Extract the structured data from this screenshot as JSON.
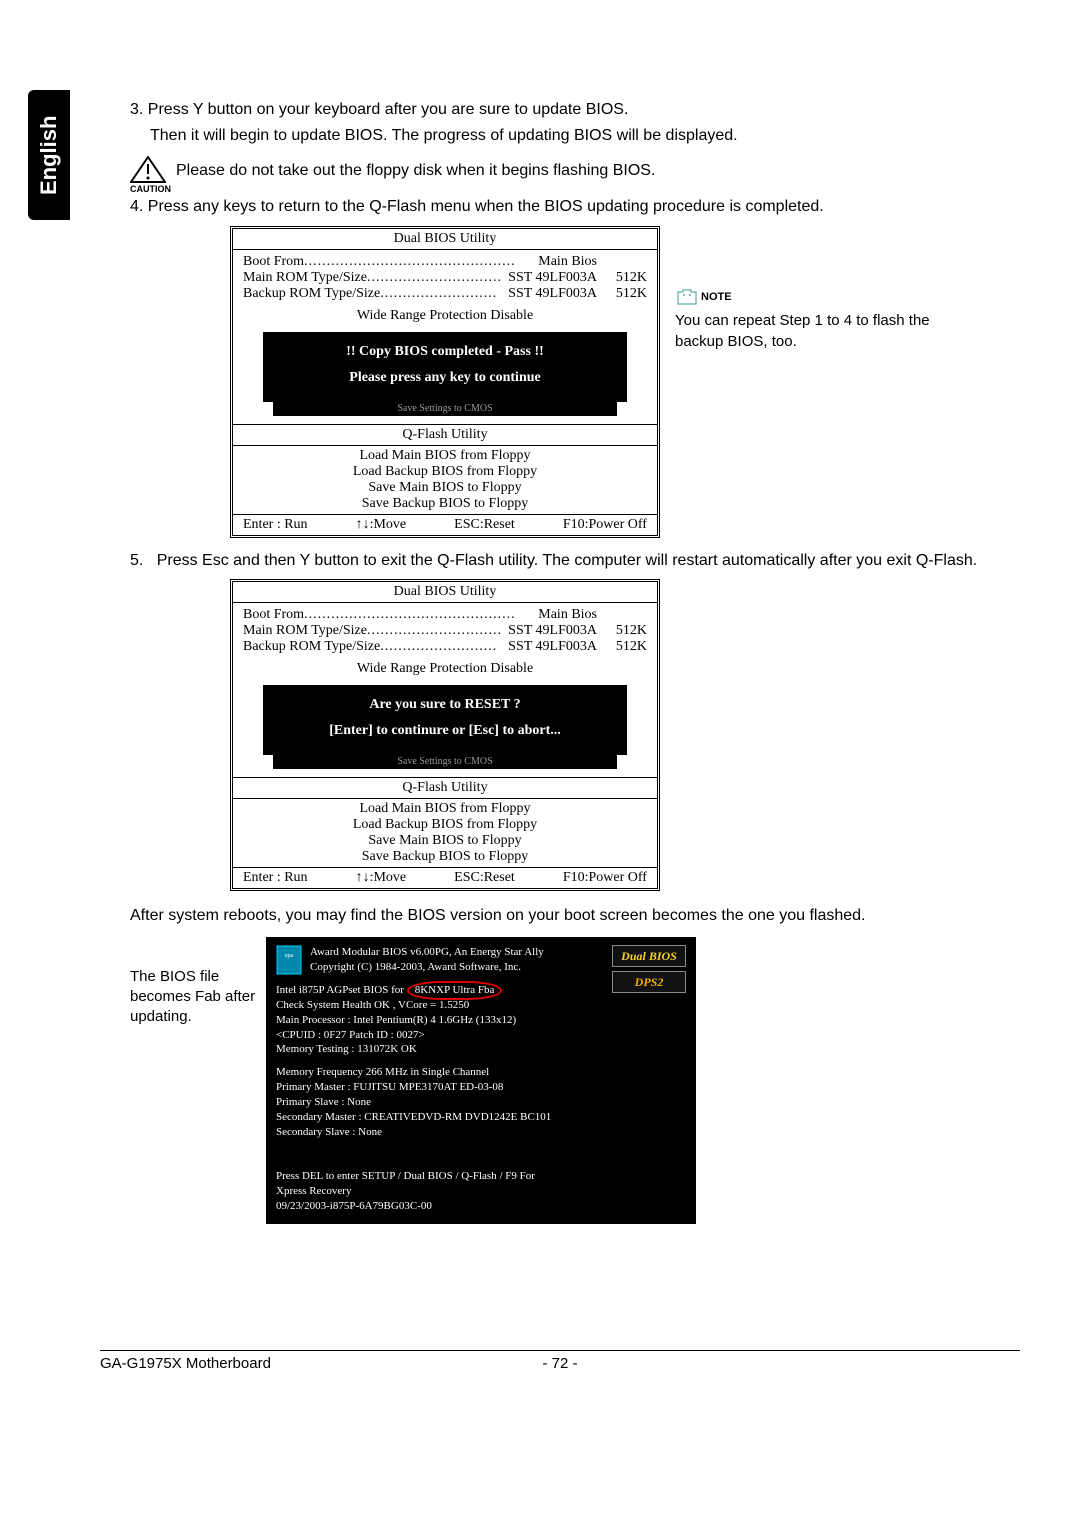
{
  "side_tab": "English",
  "step3": {
    "num": "3.",
    "line1": "Press Y button on your keyboard after you are sure to update BIOS.",
    "line2": "Then it will begin to update BIOS. The progress of updating BIOS will be displayed."
  },
  "caution": {
    "label": "CAUTION",
    "text": "Please do not take out the floppy disk when it begins flashing BIOS."
  },
  "step4": {
    "num": "4.",
    "text": "Press any keys to return to the Q-Flash menu when the BIOS updating procedure is completed."
  },
  "bios_common": {
    "title": "Dual BIOS Utility",
    "boot_from_label": "Boot From",
    "boot_from_value": "Main Bios",
    "main_rom_label": "Main ROM Type/Size",
    "main_rom_value": "SST 49LF003A",
    "main_rom_size": "512K",
    "backup_rom_label": "Backup ROM Type/Size",
    "backup_rom_value": "SST 49LF003A",
    "backup_rom_size": "512K",
    "wrp": "Wide Range Protection    Disable",
    "behind": "Save Settings to CMOS",
    "qflash": "Q-Flash Utility",
    "menu": [
      "Load Main BIOS from Floppy",
      "Load Backup BIOS from Floppy",
      "Save Main BIOS to Floppy",
      "Save Backup BIOS to Floppy"
    ],
    "keys": {
      "enter": "Enter : Run",
      "move": "↑↓:Move",
      "esc": "ESC:Reset",
      "f10": "F10:Power Off"
    }
  },
  "dialog1": {
    "line1": "!! Copy BIOS completed - Pass !!",
    "line2": "Please press any key to continue"
  },
  "note_side": {
    "label": "NOTE",
    "text": "You can repeat Step 1 to 4 to flash the backup BIOS, too."
  },
  "step5": {
    "num": "5.",
    "text": "Press Esc and then Y button to exit the Q-Flash utility. The computer will restart automatically after you exit Q-Flash."
  },
  "dialog2": {
    "line1": "Are you sure to RESET ?",
    "line2": "[Enter] to continure or [Esc] to abort..."
  },
  "after_reboot": "After system reboots, you may find the BIOS version on your boot screen becomes the one you flashed.",
  "boot_note": "The BIOS file becomes Fab after updating.",
  "boot": {
    "award1": "Award Modular BIOS v6.00PG, An Energy Star Ally",
    "award2": "Copyright  (C) 1984-2003, Award Software,  Inc.",
    "l1a": "Intel i875P AGPset BIOS for ",
    "l1b": "8KNXP Ultra Fba",
    "l2a": "Check System Health OK , VCore = 1.5250",
    "l3": "Main Processor : Intel Pentium(R) 4  1.6GHz (133x12)",
    "l4": "<CPUID : 0F27 Patch ID : 0027>",
    "l5": "Memory Testing  : 131072K OK",
    "b1": "Memory Frequency 266 MHz in Single Channel",
    "b2": "Primary Master : FUJITSU MPE3170AT ED-03-08",
    "b3": "Primary Slave : None",
    "b4": "Secondary Master : CREATIVEDVD-RM DVD1242E BC101",
    "b5": "Secondary Slave : None",
    "f1": "Press DEL to enter SETUP / Dual BIOS / Q-Flash / F9 For",
    "f2": "Xpress Recovery",
    "f3": "09/23/2003-i875P-6A79BG03C-00",
    "logo1": "Dual BIOS",
    "logo2": "DPS2"
  },
  "footer": {
    "left": "GA-G1975X Motherboard",
    "center": "- 72 -"
  }
}
